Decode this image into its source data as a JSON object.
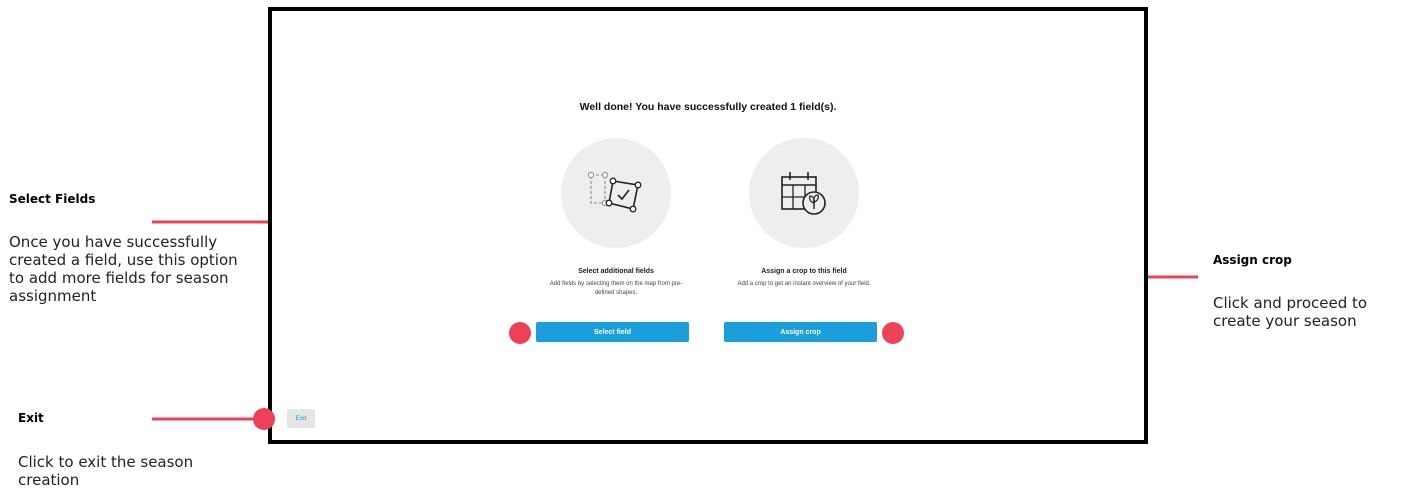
{
  "screen": {
    "headline": "Well done! You have successfully created 1 field(s).",
    "options": [
      {
        "title": "Select additional fields",
        "description": "Add fields by selecting them on the map from pre-defined shapes.",
        "button_label": "Select field",
        "icon": "field-select-icon"
      },
      {
        "title": "Assign a crop to this field",
        "description": "Add a crop to get an instant overview of your field.",
        "button_label": "Assign crop",
        "icon": "calendar-crop-icon"
      }
    ],
    "exit_label": "Exit"
  },
  "annotations": {
    "select_fields": {
      "title": "Select Fields",
      "body": "Once you have successfully created a field, use this option to add more fields for season assignment"
    },
    "assign_crop": {
      "title": "Assign crop",
      "body": "Click and proceed to create your season"
    },
    "exit": {
      "title": "Exit",
      "body": "Click to exit the season creation"
    }
  },
  "colors": {
    "button_blue": "#1a9fdb",
    "annotation_red": "#ec4257",
    "circle_gray": "#eeeeee",
    "exit_gray": "#e5e5e5"
  }
}
